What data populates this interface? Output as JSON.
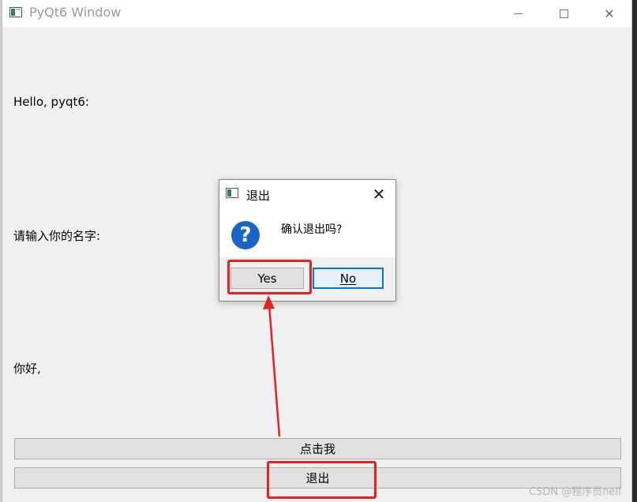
{
  "window": {
    "title": "PyQt6 Window",
    "controls": {
      "minimize": "–",
      "maximize": "□",
      "close": "✕"
    }
  },
  "labels": {
    "hello": "Hello, pyqt6:",
    "name_prompt": "请输入你的名字:",
    "greeting": "你好,"
  },
  "buttons": {
    "click_me": "点击我",
    "quit": "退出"
  },
  "dialog": {
    "title": "退出",
    "message": "确认退出吗?",
    "icon": "question-icon",
    "close": "✕",
    "yes_label": "Yes",
    "no_label": "No"
  },
  "annotation": {
    "color": "#e52222"
  },
  "watermark": "CSDN @程序员nell"
}
